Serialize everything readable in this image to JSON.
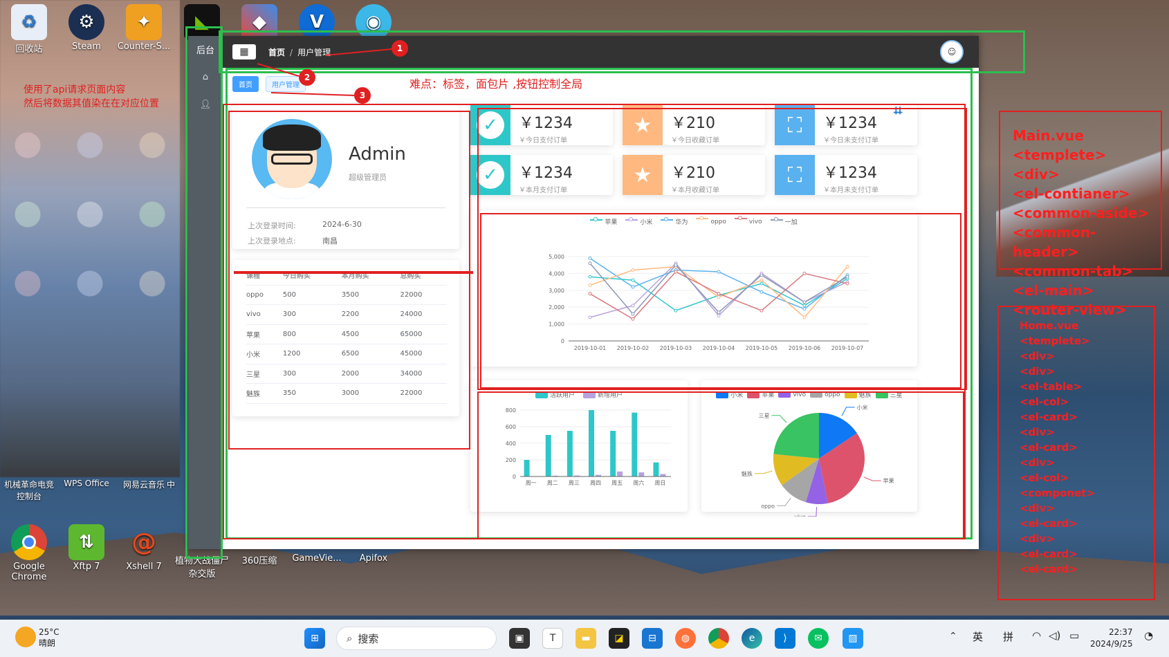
{
  "desktop": {
    "icons_top": [
      {
        "label": "回收站",
        "icon": "recycle-bin-icon"
      },
      {
        "label": "Steam",
        "icon": "steam-icon"
      },
      {
        "label": "Counter-S...",
        "icon": "counter-strike-icon"
      }
    ],
    "icons_bottom_row1": [
      "机械革命电竞控制台",
      "WPS Office",
      "网易云音乐",
      "中"
    ],
    "icons_bottom_row2": [
      "Google Chrome",
      "Xftp 7",
      "Xshell 7",
      "植物大战僵尸杂交版",
      "360压缩",
      "GameVie...",
      "Apifox"
    ],
    "note": "使用了api请求页面内容\n然后将数据其值染在在对应位置"
  },
  "app": {
    "brand": "后台",
    "breadcrumb": {
      "home": "首页",
      "sep": "/",
      "current": "用户管理"
    },
    "tabs": [
      "首页",
      "用户管理"
    ],
    "user": {
      "name": "Admin",
      "role": "超级管理员",
      "last_login_time_label": "上次登录时间:",
      "last_login_time": "2024-6-30",
      "last_login_place_label": "上次登录地点:",
      "last_login_place": "南昌"
    },
    "table": {
      "headers": [
        "课程",
        "今日购买",
        "本月购买",
        "总购买"
      ],
      "rows": [
        [
          "oppo",
          "500",
          "3500",
          "22000"
        ],
        [
          "vivo",
          "300",
          "2200",
          "24000"
        ],
        [
          "苹果",
          "800",
          "4500",
          "65000"
        ],
        [
          "小米",
          "1200",
          "6500",
          "45000"
        ],
        [
          "三星",
          "300",
          "2000",
          "34000"
        ],
        [
          "魅族",
          "350",
          "3000",
          "22000"
        ]
      ]
    },
    "orders": [
      {
        "value": "￥1234",
        "label": "￥今日支付订单",
        "color": "#2ec7c9",
        "icon": "check-icon"
      },
      {
        "value": "￥210",
        "label": "￥今日收藏订单",
        "color": "#ffb980",
        "icon": "star-icon"
      },
      {
        "value": "￥1234",
        "label": "￥今日未支付订单",
        "color": "#5ab1ef",
        "icon": "bag-icon"
      },
      {
        "value": "￥1234",
        "label": "￥本月支付订单",
        "color": "#2ec7c9",
        "icon": "check-icon"
      },
      {
        "value": "￥210",
        "label": "￥本月收藏订单",
        "color": "#ffb980",
        "icon": "star-icon"
      },
      {
        "value": "￥1234",
        "label": "￥本月未支付订单",
        "color": "#5ab1ef",
        "icon": "bag-icon"
      }
    ]
  },
  "annotations": {
    "difficulty": "难点：标签，面包片 ,按钮控制全局",
    "badges": [
      "1",
      "2",
      "3"
    ],
    "main_vue": [
      "Main.vue",
      "<templete>",
      "<div>",
      "<el-contianer>",
      "<common-aside>",
      "<common-header>",
      "<common-tab>",
      "<el-main>",
      "<router-view>"
    ],
    "home_vue": [
      "Home.vue",
      "<templete>",
      "<div>",
      "",
      "<div>",
      "<el-table>",
      "<el-col>",
      "<el-card>",
      "<div>",
      "<el-card>",
      "<div>",
      "<el-col>",
      "<componet>",
      "<div>",
      "<el-card>",
      "<div>",
      "<el-card>",
      "<el-card>"
    ]
  },
  "taskbar": {
    "weather_temp": "25°C",
    "weather_desc": "晴朗",
    "search_placeholder": "搜索",
    "ime1": "英",
    "ime2": "拼",
    "time": "22:37",
    "date": "2024/9/25"
  },
  "chart_data": [
    {
      "type": "line",
      "x": [
        "2019-10-01",
        "2019-10-02",
        "2019-10-03",
        "2019-10-04",
        "2019-10-05",
        "2019-10-06",
        "2019-10-07"
      ],
      "ylim": [
        0,
        5000
      ],
      "yticks": [
        0,
        1000,
        2000,
        3000,
        4000,
        5000
      ],
      "legend": "top",
      "series": [
        {
          "name": "苹果",
          "color": "#2ec7c9",
          "values": [
            3800,
            3600,
            1800,
            2700,
            3400,
            2100,
            3700
          ]
        },
        {
          "name": "小米",
          "color": "#b6a2de",
          "values": [
            1400,
            2100,
            4600,
            1500,
            4000,
            2300,
            3500
          ]
        },
        {
          "name": "华为",
          "color": "#5ab1ef",
          "values": [
            4900,
            3200,
            4200,
            4100,
            2900,
            1900,
            3900
          ]
        },
        {
          "name": "oppo",
          "color": "#ffb980",
          "values": [
            3300,
            4200,
            4400,
            2600,
            3600,
            1400,
            4400
          ]
        },
        {
          "name": "vivo",
          "color": "#d87a80",
          "values": [
            2800,
            1300,
            4100,
            2800,
            1800,
            4000,
            3400
          ]
        },
        {
          "name": "一加",
          "color": "#8d98b3",
          "values": [
            4600,
            1600,
            4500,
            1700,
            3900,
            2300,
            3800
          ]
        }
      ]
    },
    {
      "type": "bar",
      "categories": [
        "周一",
        "周二",
        "周三",
        "周四",
        "周五",
        "周六",
        "周日"
      ],
      "ylim": [
        0,
        800
      ],
      "yticks": [
        0,
        200,
        400,
        600,
        800
      ],
      "legend": "top",
      "series": [
        {
          "name": "活跃用户",
          "color": "#2ec7c9",
          "values": [
            200,
            500,
            550,
            800,
            550,
            770,
            170
          ]
        },
        {
          "name": "新增用户",
          "color": "#b6a2de",
          "values": [
            5,
            10,
            12,
            20,
            60,
            50,
            30
          ]
        }
      ]
    },
    {
      "type": "pie",
      "legend": "top",
      "slices": [
        {
          "name": "小米",
          "value": 2999,
          "color": "#0f78f4"
        },
        {
          "name": "苹果",
          "value": 5999,
          "color": "#dd536b"
        },
        {
          "name": "vivo",
          "value": 1500,
          "color": "#9462e5"
        },
        {
          "name": "oppo",
          "value": 1999,
          "color": "#a6a6a6"
        },
        {
          "name": "魅族",
          "value": 2200,
          "color": "#e1bb22"
        },
        {
          "name": "三星",
          "value": 4500,
          "color": "#39c362"
        }
      ]
    }
  ]
}
